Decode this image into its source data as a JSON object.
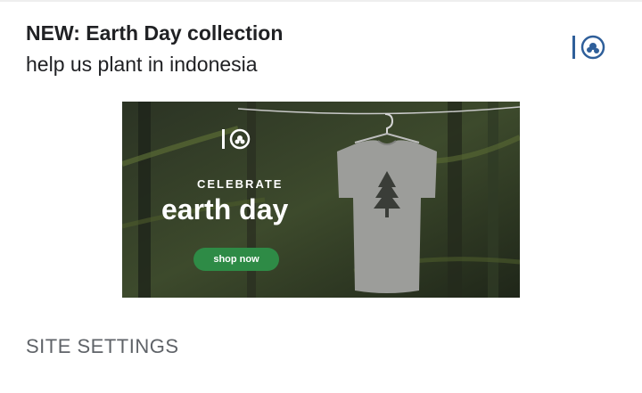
{
  "notification": {
    "title": "NEW: Earth Day collection",
    "body": "help us plant in indonesia",
    "app_icon": "tentree-logo-icon"
  },
  "banner": {
    "celebrate_text": "CELEBRATE",
    "headline": "earth day",
    "cta_label": "shop now",
    "cta_color": "#2e8b46",
    "logo_icon": "tentree-logo-icon"
  },
  "settings_label": "SITE SETTINGS",
  "colors": {
    "accent": "#2e8b46",
    "brand_blue": "#2f5f9a"
  }
}
